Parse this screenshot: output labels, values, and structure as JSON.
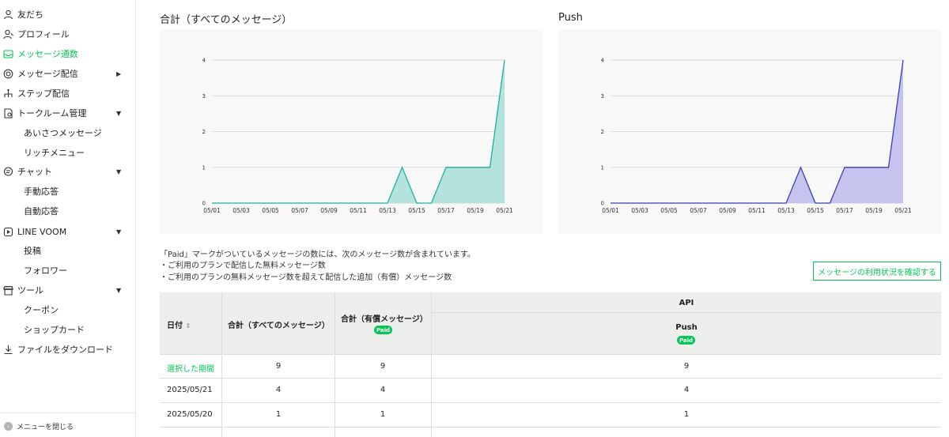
{
  "sidebar": {
    "items": [
      {
        "label": "友だち",
        "icon": "friends-icon"
      },
      {
        "label": "プロフィール",
        "icon": "profile-icon"
      },
      {
        "label": "メッセージ通数",
        "icon": "message-count-icon",
        "active": true
      },
      {
        "label": "メッセージ配信",
        "icon": "broadcast-icon"
      },
      {
        "label": "ステップ配信",
        "icon": "step-icon"
      },
      {
        "label": "トークルーム管理",
        "icon": "talkroom-icon"
      },
      {
        "label": "あいさつメッセージ"
      },
      {
        "label": "リッチメニュー"
      },
      {
        "label": "チャット",
        "icon": "chat-icon"
      },
      {
        "label": "手動応答"
      },
      {
        "label": "自動応答"
      },
      {
        "label": "LINE VOOM",
        "icon": "voom-icon"
      },
      {
        "label": "投稿"
      },
      {
        "label": "フォロワー"
      },
      {
        "label": "ツール",
        "icon": "tools-icon"
      },
      {
        "label": "クーポン"
      },
      {
        "label": "ショップカード"
      },
      {
        "label": "ファイルをダウンロード",
        "icon": "download-icon"
      }
    ],
    "collapse_label": "メニューを閉じる"
  },
  "charts": {
    "total_title": "合計（すべてのメッセージ）",
    "push_title": "Push"
  },
  "chart_data": [
    {
      "type": "area",
      "title": "合計（すべてのメッセージ）",
      "x": [
        "05/01",
        "05/02",
        "05/03",
        "05/04",
        "05/05",
        "05/06",
        "05/07",
        "05/08",
        "05/09",
        "05/10",
        "05/11",
        "05/12",
        "05/13",
        "05/14",
        "05/15",
        "05/16",
        "05/17",
        "05/18",
        "05/19",
        "05/20",
        "05/21"
      ],
      "xticks": [
        "05/01",
        "05/03",
        "05/05",
        "05/07",
        "05/09",
        "05/11",
        "05/13",
        "05/15",
        "05/17",
        "05/19",
        "05/21"
      ],
      "y": [
        0,
        0,
        0,
        0,
        0,
        0,
        0,
        0,
        0,
        0,
        0,
        0,
        0,
        1,
        0,
        0,
        1,
        1,
        1,
        1,
        4
      ],
      "ylim": [
        0,
        4
      ],
      "yticks": [
        0,
        1,
        2,
        3,
        4
      ],
      "grid": true,
      "line_color": "#1fb09c",
      "fill_color": "#b3e3dc"
    },
    {
      "type": "area",
      "title": "Push",
      "x": [
        "05/01",
        "05/02",
        "05/03",
        "05/04",
        "05/05",
        "05/06",
        "05/07",
        "05/08",
        "05/09",
        "05/10",
        "05/11",
        "05/12",
        "05/13",
        "05/14",
        "05/15",
        "05/16",
        "05/17",
        "05/18",
        "05/19",
        "05/20",
        "05/21"
      ],
      "xticks": [
        "05/01",
        "05/03",
        "05/05",
        "05/07",
        "05/09",
        "05/11",
        "05/13",
        "05/15",
        "05/17",
        "05/19",
        "05/21"
      ],
      "y": [
        0,
        0,
        0,
        0,
        0,
        0,
        0,
        0,
        0,
        0,
        0,
        0,
        0,
        1,
        0,
        0,
        1,
        1,
        1,
        1,
        4
      ],
      "ylim": [
        0,
        4
      ],
      "yticks": [
        0,
        1,
        2,
        3,
        4
      ],
      "grid": true,
      "line_color": "#3d3db8",
      "fill_color": "#c4c4ee"
    }
  ],
  "notes": {
    "line1": "「Paid」マークがついているメッセージの数には、次のメッセージ数が含まれています。",
    "line2": "・ご利用のプランで配信した無料メッセージ数",
    "line3": "・ご利用のプランの無料メッセージ数を超えて配信した追加（有償）メッセージ数"
  },
  "check_button": "メッセージの利用状況を確認する",
  "table": {
    "headers": {
      "date": "日付",
      "total": "合計（すべてのメッセージ）",
      "paid_total": "合計（有償メッセージ）",
      "api": "API",
      "push": "Push",
      "paid_badge": "Paid"
    },
    "rows": [
      {
        "date": "選択した期間",
        "total": "9",
        "paid": "9",
        "push": "9"
      },
      {
        "date": "2025/05/21",
        "total": "4",
        "paid": "4",
        "push": "4"
      },
      {
        "date": "2025/05/20",
        "total": "1",
        "paid": "1",
        "push": "1"
      }
    ]
  },
  "colors": {
    "accent": "#06c755"
  }
}
